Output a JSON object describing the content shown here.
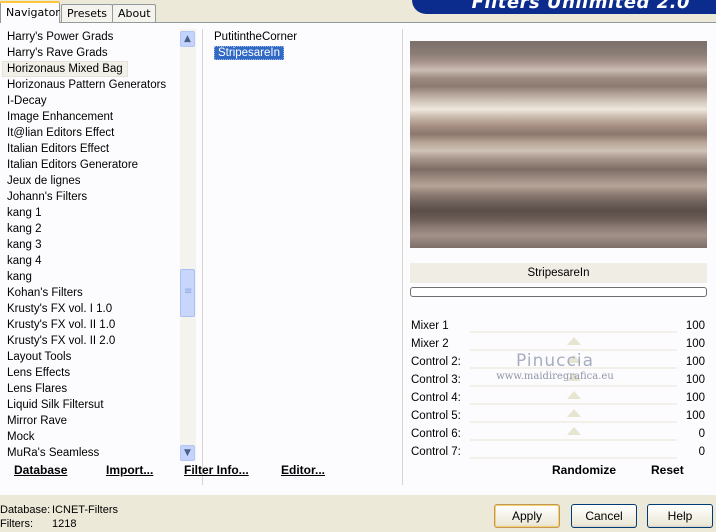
{
  "tabs": [
    {
      "label": "Navigator",
      "active": true
    },
    {
      "label": "Presets",
      "active": false
    },
    {
      "label": "About",
      "active": false
    }
  ],
  "banner": {
    "title": "Filters Unlimited 2.0"
  },
  "categories": [
    {
      "label": "Harry's Power Grads"
    },
    {
      "label": "Harry's Rave Grads"
    },
    {
      "label": "Horizonaus Mixed Bag",
      "selected": true
    },
    {
      "label": "Horizonaus Pattern Generators"
    },
    {
      "label": "I-Decay"
    },
    {
      "label": "Image Enhancement"
    },
    {
      "label": "It@lian Editors Effect"
    },
    {
      "label": "Italian Editors Effect"
    },
    {
      "label": "Italian Editors Generatore"
    },
    {
      "label": "Jeux de lignes"
    },
    {
      "label": "Johann's Filters"
    },
    {
      "label": "kang 1"
    },
    {
      "label": "kang 2"
    },
    {
      "label": "kang 3"
    },
    {
      "label": "kang 4"
    },
    {
      "label": "kang"
    },
    {
      "label": "Kohan's Filters"
    },
    {
      "label": "Krusty's FX vol. I 1.0"
    },
    {
      "label": "Krusty's FX vol. II 1.0"
    },
    {
      "label": "Krusty's FX vol. II 2.0"
    },
    {
      "label": "Layout Tools"
    },
    {
      "label": "Lens Effects"
    },
    {
      "label": "Lens Flares"
    },
    {
      "label": "Liquid Silk Filtersut"
    },
    {
      "label": "Mirror Rave"
    },
    {
      "label": "Mock"
    },
    {
      "label": "MuRa's Seamless"
    }
  ],
  "filters": [
    {
      "label": "PutitintheCorner"
    },
    {
      "label": "StripesareIn",
      "selected": true
    }
  ],
  "preview": {
    "filter_name": "StripesareIn"
  },
  "controls": [
    {
      "label": "Mixer 1",
      "value": "100",
      "level": 0.5
    },
    {
      "label": "Mixer 2",
      "value": "100",
      "level": 0.5
    },
    {
      "label": "Control 2:",
      "value": "100",
      "level": 0.5
    },
    {
      "label": "Control 3:",
      "value": "100",
      "level": 0.5
    },
    {
      "label": "Control 4:",
      "value": "100",
      "level": 0.5
    },
    {
      "label": "Control 5:",
      "value": "100",
      "level": 0.5
    },
    {
      "label": "Control 6:",
      "value": "0",
      "level": 0
    },
    {
      "label": "Control 7:",
      "value": "0",
      "level": 0
    }
  ],
  "watermark": {
    "line1": "Pinuccia",
    "line2": "www.maidiregrafica.eu"
  },
  "actions": {
    "database": "Database",
    "import": "Import...",
    "filter_info": "Filter Info...",
    "editor": "Editor...",
    "randomize": "Randomize",
    "reset": "Reset"
  },
  "footer": {
    "database_label": "Database:",
    "database_value": "ICNET-Filters",
    "filters_label": "Filters:",
    "filters_value": "1218",
    "apply": "Apply",
    "cancel": "Cancel",
    "help": "Help"
  }
}
